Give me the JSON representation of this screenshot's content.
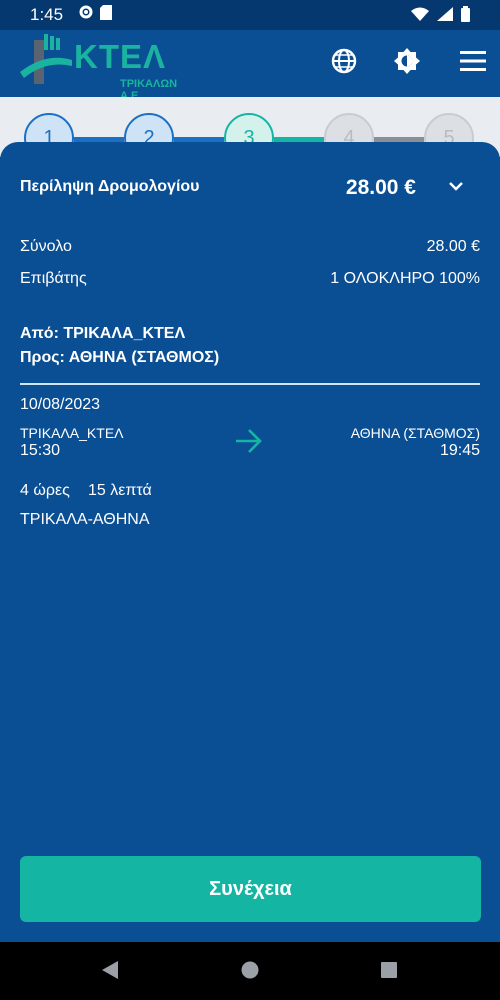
{
  "status": {
    "time": "1:45"
  },
  "header": {
    "logo_main": "ΚΤΕΛ",
    "logo_sub": "ΤΡΙΚΑΛΩΝ Α.Ε.",
    "globe_icon": "globe-icon",
    "theme_icon": "brightness-icon",
    "menu_icon": "hamburger-menu-icon"
  },
  "stepper": {
    "steps": [
      "1",
      "2",
      "3",
      "4",
      "5"
    ],
    "active": 3
  },
  "summary": {
    "title": "Περίληψη Δρομολογίου",
    "price": "28.00 €",
    "total_label": "Σύνολο",
    "total_value": "28.00 €",
    "passengers_label": "Επιβάτης",
    "passengers_value": "1 ΟΛΟΚΛΗΡΟ 100%",
    "from": "Από: ΤΡΙΚΑΛΑ_ΚΤΕΛ",
    "to": "Προς: ΑΘΗΝΑ (ΣΤΑΘΜΟΣ)",
    "date": "10/08/2023",
    "dep_station": "ΤΡΙΚΑΛΑ_ΚΤΕΛ",
    "dep_time": "15:30",
    "arr_station": "ΑΘΗΝΑ (ΣΤΑΘΜΟΣ)",
    "arr_time": "19:45",
    "duration_hours": "4 ώρες",
    "duration_minutes": "15 λεπτά",
    "route_name": "ΤΡΙΚΑΛΑ-ΑΘΗΝΑ"
  },
  "actions": {
    "continue_label": "Συνέχεια"
  },
  "colors": {
    "primary": "#0a4f94",
    "accent": "#15b5a4",
    "status_bar": "#05386f"
  }
}
